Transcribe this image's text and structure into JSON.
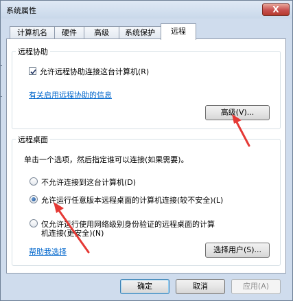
{
  "window": {
    "title": "系统属性",
    "close_glyph": "X"
  },
  "tabs": [
    {
      "label": "计算机名",
      "active": false
    },
    {
      "label": "硬件",
      "active": false
    },
    {
      "label": "高级",
      "active": false
    },
    {
      "label": "系统保护",
      "active": false
    },
    {
      "label": "远程",
      "active": true
    }
  ],
  "remote_assistance": {
    "title": "远程协助",
    "allow_label": "允许远程协助连接这台计算机(R)",
    "allow_checked": true,
    "info_link": "有关启用远程协助的信息",
    "advanced_button": "高级(V)..."
  },
  "remote_desktop": {
    "title": "远程桌面",
    "instructions": "单击一个选项，然后指定谁可以连接(如果需要)。",
    "options": [
      {
        "label": "不允许连接到这台计算机(D)",
        "selected": false
      },
      {
        "label": "允许运行任意版本远程桌面的计算机连接(较不安全)(L)",
        "selected": true
      },
      {
        "label_line1": "仅允许运行使用网络级别身份验证的远程桌面的计算",
        "label_line2": "机连接(更安全)(N)",
        "selected": false
      }
    ],
    "help_link": "帮助我选择",
    "select_users_button": "选择用户(S)..."
  },
  "footer": {
    "ok": "确定",
    "cancel": "取消",
    "apply": "应用(A)"
  },
  "colors": {
    "annotation_arrow": "#e53935",
    "link": "#0066cc",
    "frame": "#cfdced"
  }
}
